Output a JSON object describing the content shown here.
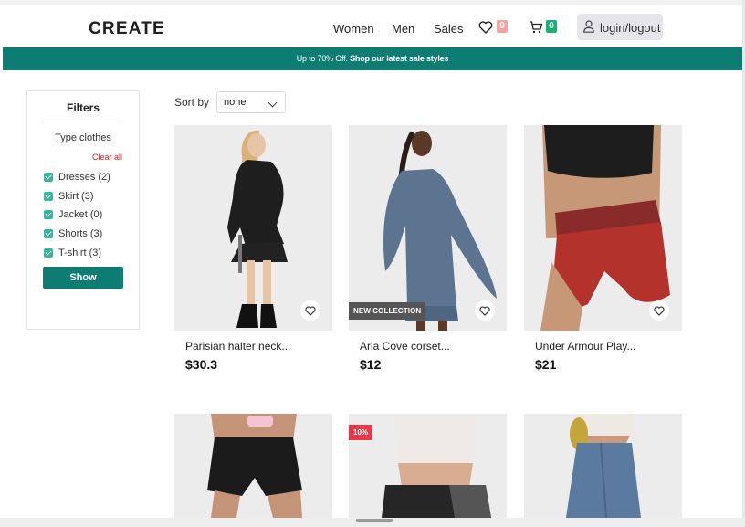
{
  "brand": {
    "logo": "CREATE"
  },
  "nav": {
    "women": "Women",
    "men": "Men",
    "sales": "Sales",
    "favorites_count": "0",
    "cart_count": "0",
    "login_label": "login/logout"
  },
  "promo": {
    "discount": "Up to 70% Off.",
    "cta": "Shop our latest sale styles"
  },
  "filters": {
    "title": "Filters",
    "type_label": "Type clothes",
    "clear_all": "Clear all",
    "items": [
      {
        "label": "Dresses (2)",
        "checked": true
      },
      {
        "label": "Skirt (3)",
        "checked": true
      },
      {
        "label": "Jacket (0)",
        "checked": true
      },
      {
        "label": "Shorts (3)",
        "checked": true
      },
      {
        "label": "T-shirt (3)",
        "checked": true
      }
    ],
    "show_button": "Show"
  },
  "sort": {
    "label": "Sort by",
    "value": "none"
  },
  "products": [
    {
      "name": "Parisian halter neck...",
      "price": "$30.3"
    },
    {
      "name": "Aria Cove corset...",
      "price": "$12",
      "tag": "NEW COLLECTION"
    },
    {
      "name": "Under Armour Play...",
      "price": "$21"
    },
    {
      "tag": ""
    },
    {
      "tag": "10%"
    },
    {
      "tag": ""
    }
  ],
  "colors": {
    "accent": "#0d7c73",
    "checkbox": "#36b59e",
    "favorites_badge": "#f4a3a0",
    "cart_badge": "#19b070",
    "sale_tag": "#e8394a",
    "clear_all": "#d01f1f"
  }
}
